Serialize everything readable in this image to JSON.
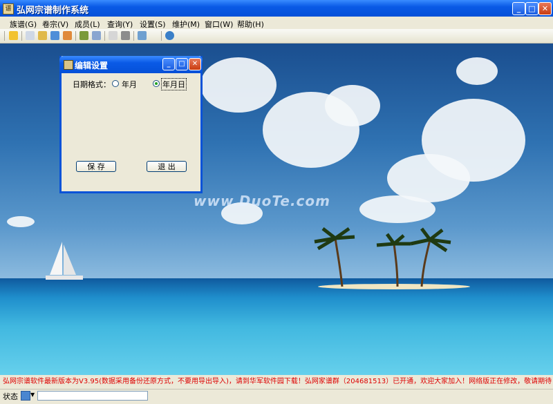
{
  "window": {
    "title": "弘网宗谱制作系统",
    "minimize": "_",
    "maximize": "□",
    "close": "✕"
  },
  "menu": [
    "族谱(G)",
    "卷宗(V)",
    "成员(L)",
    "查询(Y)",
    "设置(S)",
    "维护(M)",
    "窗口(W)",
    "帮助(H)"
  ],
  "dialog": {
    "title": "编辑设置",
    "date_format_label": "日期格式：",
    "options": [
      "年月",
      "年月日"
    ],
    "selected_option": "年月日",
    "save_label": "保 存",
    "exit_label": "退 出"
  },
  "desktop": {
    "watermark": "www.DuoTe.com"
  },
  "info_line": "弘网宗谱软件最新版本为V3.95(数据采用备份还原方式，不要用导出导入)，请到华军软件园下载！弘网家谱群（204681513）已开通，欢迎大家加入！网络版正在修改，敬请期待",
  "statusbar": {
    "label": "状态"
  },
  "colors": {
    "titlebar": "#0a5ae6",
    "chrome": "#ece9d8",
    "info_text": "#dd0000"
  }
}
